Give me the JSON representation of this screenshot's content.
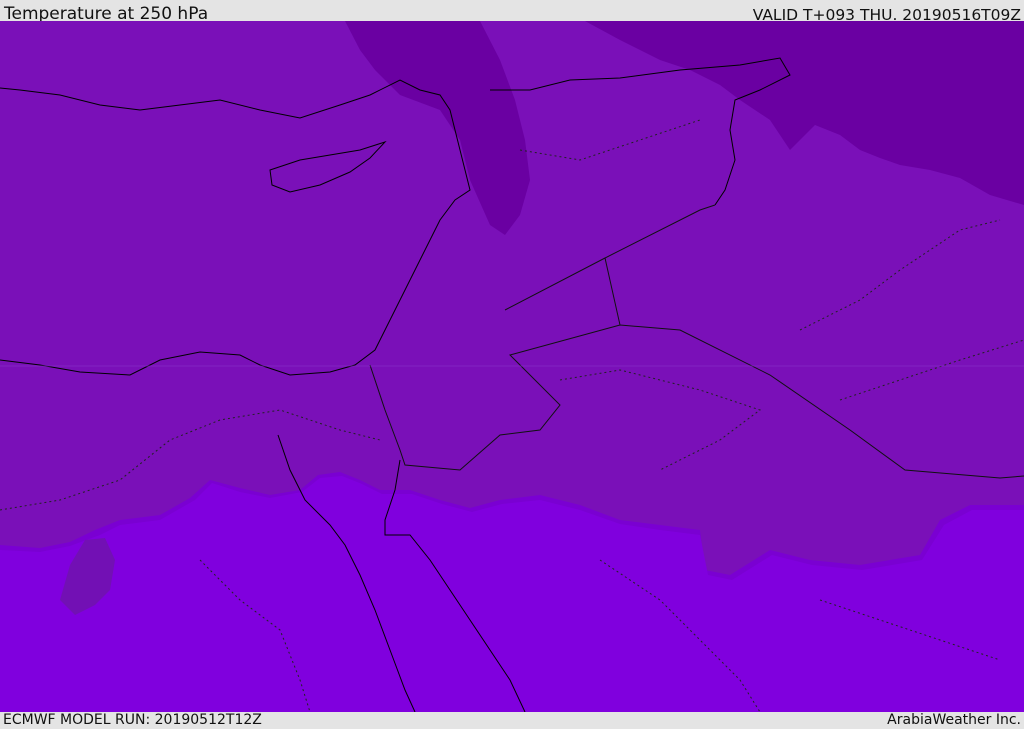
{
  "header": {
    "title": "Temperature at 250 hPa",
    "valid": "VALID T+093 THU. 20190516T09Z"
  },
  "footer": {
    "model_run": "ECMWF MODEL RUN: 20190512T12Z",
    "credit": "ArabiaWeather Inc."
  },
  "colors": {
    "band_coldest": "#6800a0",
    "band_cold": "#7210b4",
    "band_mid": "#7a00cc",
    "band_warm": "#8000de",
    "coastline": "#000000",
    "border": "#202020"
  }
}
